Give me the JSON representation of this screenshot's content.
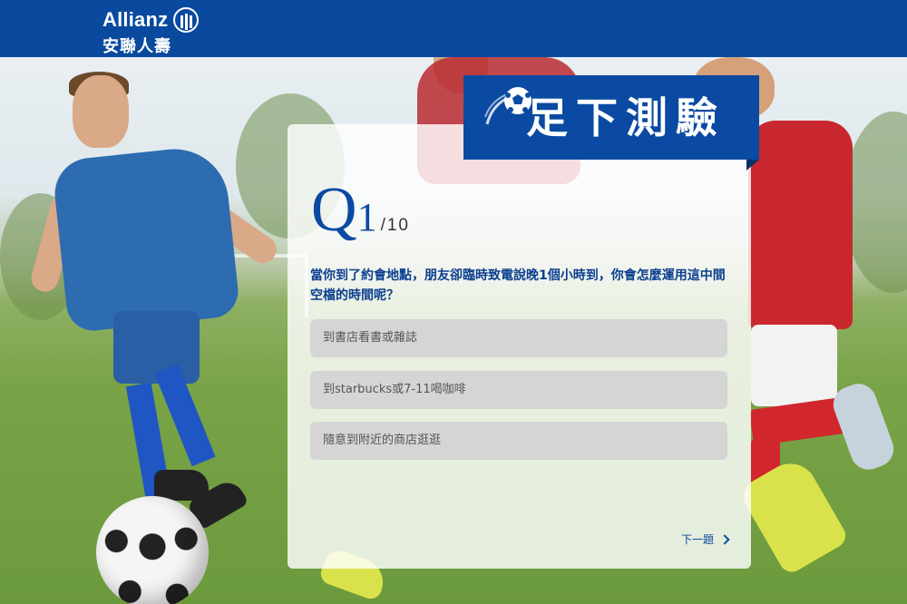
{
  "brand": {
    "name": "Allianz",
    "subtitle": "安聯人壽",
    "color": "#0a4a9e"
  },
  "quiz": {
    "title": "足下測驗",
    "question_label": "Q",
    "question_number": "1",
    "question_total": "/10",
    "question_text": "當你到了約會地點，朋友卻臨時致電說晚1個小時到，你會怎麼運用這中間空檔的時間呢？",
    "options": [
      {
        "label": "到書店看書或雜誌"
      },
      {
        "label": "到starbucks或7-11喝咖啡"
      },
      {
        "label": "隨意到附近的商店逛逛"
      }
    ],
    "next_label": "下一題"
  },
  "colors": {
    "accent": "#0b4aa2",
    "option_bg": "#d5d5d5"
  },
  "icons": {
    "logo": "allianz-eagle-icon",
    "title_ball": "soccer-ball-icon",
    "next": "chevron-right-icon"
  }
}
